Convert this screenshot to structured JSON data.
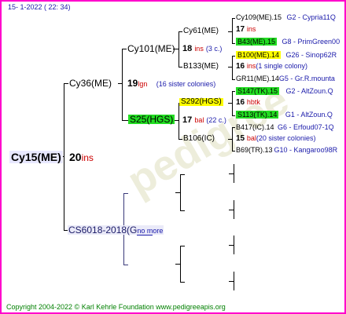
{
  "header": {
    "date": "15-   1-2022 ( 22:  34)"
  },
  "footer": {
    "copyright": "Copyright 2004-2022 © Karl Kehrle Foundation    www.pedigreeapis.org"
  },
  "gen1": {
    "name": "Cy15(ME)",
    "num": "20",
    "suffix": "ins"
  },
  "gen2": [
    {
      "name": "Cy36(ME)",
      "num": "19",
      "suffix": "lgn",
      "note": "(16 sister colonies)"
    },
    {
      "name": "CS6018-2018(G",
      "more": "no more"
    }
  ],
  "gen3": [
    {
      "name": "Cy101(ME)",
      "num": "18",
      "suffix": "ins",
      "note": "(3 c.)"
    },
    {
      "name": "S25(HGS)",
      "num": "17",
      "suffix": "bal",
      "note": "(22 c.)"
    }
  ],
  "gen4": [
    {
      "name": "Cy61(ME)",
      "num": "17",
      "suffix": "ins"
    },
    {
      "name": "B133(ME)"
    },
    {
      "name": "S292(HGS)",
      "num": "16",
      "suffix": "hbtk"
    },
    {
      "name": "B106(IC)",
      "num": "15",
      "suffix": "bal",
      "note": "(20 sister colonies)"
    }
  ],
  "gen5": [
    {
      "name": "Cy109(ME).15",
      "code": "G2 - Cypria11Q"
    },
    {
      "name": "B43(ME).15",
      "code": "G8 - PrimGreen00"
    },
    {
      "name": "B100(ME).14",
      "code": "G26 - Sinop62R"
    },
    {
      "name": "16",
      "suffix": "ins",
      "note": "(1 single colony)"
    },
    {
      "name": "GR11(ME).14",
      "code": "G5 - Gr.R.mounta"
    },
    {
      "name": "S147(TK).15",
      "code": "G2 - AltZoun.Q"
    },
    {
      "name": "S113(TK).14",
      "code": "G1 - AltZoun.Q"
    },
    {
      "name": "B417(IC).14",
      "code": "G6 - Erfoud07-1Q"
    },
    {
      "name": "B69(TR).13",
      "code": "G10 - Kangaroo98R"
    }
  ],
  "colors": {
    "border": "#ff00cc",
    "highlight_green": "#22dd22",
    "highlight_yellow": "#ffff00",
    "accent_red": "#cc0000",
    "accent_blue": "#1a1aaa",
    "footer_green": "#008000"
  }
}
